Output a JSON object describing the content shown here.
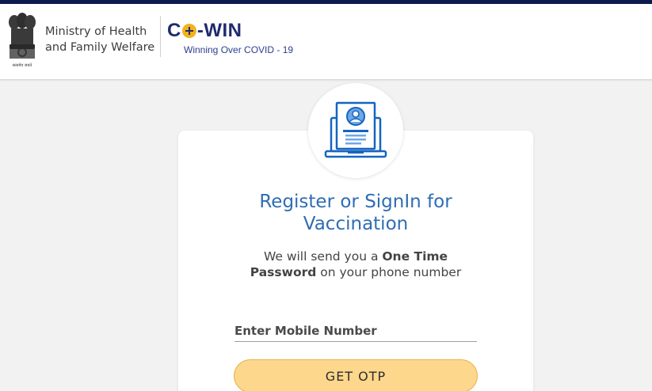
{
  "header": {
    "emblem_caption": "सत्यमेव जयते",
    "ministry_line1": "Ministry of Health",
    "ministry_line2": "and Family Welfare",
    "logo_left": "C",
    "logo_right": "-WIN",
    "tagline": "Winning Over COVID - 19"
  },
  "card": {
    "icon": "laptop-id-card-icon",
    "title_line1": "Register or SignIn for",
    "title_line2": "Vaccination",
    "subtitle_prefix": "We will send you a ",
    "subtitle_bold1": "One Time",
    "subtitle_bold2": "Password",
    "subtitle_suffix": " on your phone number",
    "mobile_placeholder": "Enter Mobile Number",
    "otp_button": "GET OTP"
  },
  "colors": {
    "top_bar": "#0d1b4c",
    "title": "#2e6db4",
    "button_bg": "#fdd78c",
    "logo_navy": "#1f2b6e",
    "logo_plus": "#f2b21b",
    "icon_blue": "#1565c0"
  }
}
